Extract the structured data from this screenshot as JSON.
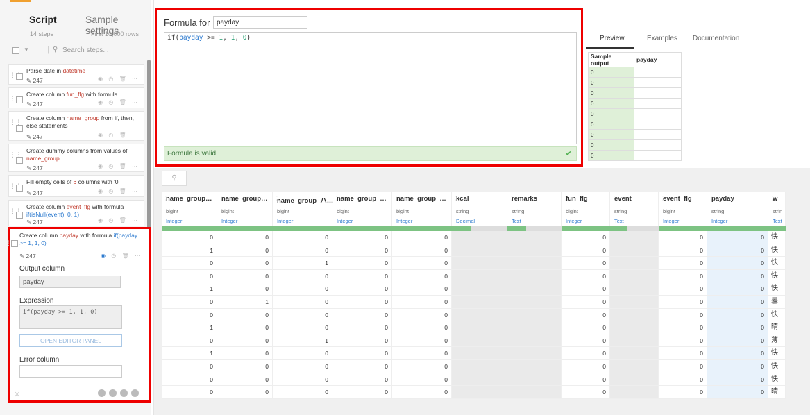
{
  "left_panel": {
    "tab_script": "Script",
    "tab_sample": "Sample settings",
    "steps_count": "14 steps",
    "rows_label": "First 10,000 rows",
    "search_placeholder": "Search steps..."
  },
  "steps": [
    {
      "pre": "Parse date in ",
      "hl": "datetime",
      "post": "",
      "count": "247"
    },
    {
      "pre": "Create column ",
      "hl": "fun_flg",
      "post": " with formula",
      "count": "247"
    },
    {
      "pre": "Create column ",
      "hl": "name_group",
      "post": " from if, then, else statements",
      "count": "247"
    },
    {
      "pre": "Create dummy columns from values of ",
      "hl": "name_group",
      "post": "",
      "count": "247"
    },
    {
      "pre": "Fill empty cells of ",
      "hl": "6",
      "post": " columns with '0'",
      "count": "247"
    },
    {
      "pre": "Create column ",
      "hl": "event_flg",
      "post": " with formula ",
      "hlb": "if(isNull(event), 0, 1)",
      "count": "247"
    }
  ],
  "step_detail": {
    "pre": "Create column ",
    "hl": "payday",
    "post": " with formula ",
    "hlb": "if(payday >= 1, 1, 0)",
    "count": "247",
    "output_label": "Output column",
    "output_value": "payday",
    "expression_label": "Expression",
    "expression_value": "if(payday >= 1, 1, 0)",
    "editor_button": "OPEN EDITOR PANEL",
    "error_label": "Error column"
  },
  "formula": {
    "label": "Formula for",
    "column": "payday",
    "tokens": {
      "fn": "if(",
      "var": "payday",
      "op": " >= ",
      "n1": "1",
      "c1": ", ",
      "n2": "1",
      "c2": ", ",
      "n3": "0",
      "end": ")"
    },
    "valid_text": "Formula is valid"
  },
  "preview": {
    "tab_preview": "Preview",
    "tab_examples": "Examples",
    "tab_docs": "Documentation",
    "col_output": "Sample output",
    "col_payday": "payday",
    "rows": [
      "0",
      "0",
      "0",
      "0",
      "0",
      "0",
      "0",
      "0",
      "0"
    ]
  },
  "grid": {
    "columns": [
      {
        "name": "name_group…",
        "type": "bigint",
        "meaning": "Integer",
        "w": 80
      },
      {
        "name": "name_group…",
        "type": "bigint",
        "meaning": "Integer",
        "w": 80
      },
      {
        "name": "name_group_ハ…",
        "type": "bigint",
        "meaning": "Integer",
        "w": 86
      },
      {
        "name": "name_group_…",
        "type": "bigint",
        "meaning": "Integer",
        "w": 86
      },
      {
        "name": "name_group_…",
        "type": "bigint",
        "meaning": "Integer",
        "w": 86
      },
      {
        "name": "kcal",
        "type": "string",
        "meaning": "Decimal",
        "w": 80
      },
      {
        "name": "remarks",
        "type": "string",
        "meaning": "Text",
        "w": 78
      },
      {
        "name": "fun_flg",
        "type": "bigint",
        "meaning": "Integer",
        "w": 70
      },
      {
        "name": "event",
        "type": "string",
        "meaning": "Text",
        "w": 70
      },
      {
        "name": "event_flg",
        "type": "bigint",
        "meaning": "Integer",
        "w": 70
      },
      {
        "name": "payday",
        "type": "string",
        "meaning": "Integer",
        "w": 88
      },
      {
        "name": "w",
        "type": "strin",
        "meaning": "Text",
        "w": 25
      }
    ],
    "rows": [
      [
        "0",
        "0",
        "0",
        "0",
        "0",
        "",
        "",
        "0",
        "",
        "0",
        "0",
        "快"
      ],
      [
        "1",
        "0",
        "0",
        "0",
        "0",
        "",
        "",
        "0",
        "",
        "0",
        "0",
        "快"
      ],
      [
        "0",
        "0",
        "1",
        "0",
        "0",
        "",
        "",
        "0",
        "",
        "0",
        "0",
        "快"
      ],
      [
        "0",
        "0",
        "0",
        "0",
        "0",
        "",
        "",
        "0",
        "",
        "0",
        "0",
        "快"
      ],
      [
        "1",
        "0",
        "0",
        "0",
        "0",
        "",
        "",
        "0",
        "",
        "0",
        "0",
        "快"
      ],
      [
        "0",
        "1",
        "0",
        "0",
        "0",
        "",
        "",
        "0",
        "",
        "0",
        "0",
        "曇"
      ],
      [
        "0",
        "0",
        "0",
        "0",
        "0",
        "",
        "",
        "0",
        "",
        "0",
        "0",
        "快"
      ],
      [
        "1",
        "0",
        "0",
        "0",
        "0",
        "",
        "",
        "0",
        "",
        "0",
        "0",
        "晴"
      ],
      [
        "0",
        "0",
        "1",
        "0",
        "0",
        "",
        "",
        "0",
        "",
        "0",
        "0",
        "薄"
      ],
      [
        "1",
        "0",
        "0",
        "0",
        "0",
        "",
        "",
        "0",
        "",
        "0",
        "0",
        "快"
      ],
      [
        "0",
        "0",
        "0",
        "0",
        "0",
        "",
        "",
        "0",
        "",
        "0",
        "0",
        "快"
      ],
      [
        "0",
        "0",
        "0",
        "0",
        "0",
        "",
        "",
        "0",
        "",
        "0",
        "0",
        "快"
      ],
      [
        "0",
        "0",
        "0",
        "0",
        "0",
        "",
        "",
        "0",
        "",
        "0",
        "0",
        "晴"
      ]
    ]
  }
}
